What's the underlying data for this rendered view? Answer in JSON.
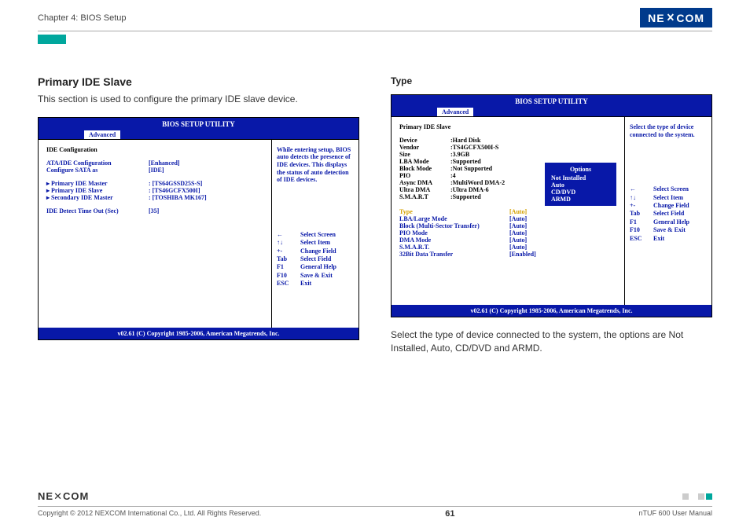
{
  "header": {
    "chapter": "Chapter 4: BIOS Setup",
    "brand": "NEXCOM"
  },
  "left": {
    "title": "Primary IDE Slave",
    "desc": "This section is used to configure the primary IDE slave device.",
    "bios": {
      "title": "BIOS SETUP UTILITY",
      "tab": "Advanced",
      "heading": "IDE Configuration",
      "rows1": [
        {
          "k": "ATA/IDE Configuration",
          "v": "[Enhanced]"
        },
        {
          "k": "Configure SATA as",
          "v": "[IDE]"
        }
      ],
      "rows2": [
        {
          "k": "▸ Primary IDE Master",
          "v": ":  [TS64GSSD25S-S]"
        },
        {
          "k": "▸ Primary IDE Slave",
          "v": ":  [TS46GCFX500I]"
        },
        {
          "k": "▸ Secondary IDE Master",
          "v": ":  [TOSHIBA MK167]"
        }
      ],
      "rows3": [
        {
          "k": "IDE Detect Time Out (Sec)",
          "v": "[35]"
        }
      ],
      "help": "While entering setup, BIOS auto detects the presence of IDE devices. This displays the status of auto detection of IDE devices.",
      "nav": [
        {
          "k": "←",
          "v": "Select Screen"
        },
        {
          "k": "↑↓",
          "v": "Select Item"
        },
        {
          "k": "+-",
          "v": "Change Field"
        },
        {
          "k": "Tab",
          "v": "Select Field"
        },
        {
          "k": "F1",
          "v": "General Help"
        },
        {
          "k": "F10",
          "v": "Save & Exit"
        },
        {
          "k": "ESC",
          "v": "Exit"
        }
      ],
      "copyright": "v02.61 (C) Copyright 1985-2006, American Megatrends, Inc."
    }
  },
  "right": {
    "title": "Type",
    "bios": {
      "title": "BIOS SETUP UTILITY",
      "tab": "Advanced",
      "heading": "Primary IDE Slave",
      "device": [
        {
          "k": "Device",
          "v": ":Hard Disk"
        },
        {
          "k": "Vendor",
          "v": ":TS4GCFX500I-S"
        },
        {
          "k": "Size",
          "v": ":3.9GB"
        },
        {
          "k": "LBA Mode",
          "v": ":Supported"
        },
        {
          "k": "Block Mode",
          "v": ":Not Supported"
        },
        {
          "k": "PIO",
          "v": ":4"
        },
        {
          "k": "Async DMA",
          "v": ":MultiWord DMA-2"
        },
        {
          "k": "Ultra DMA",
          "v": ":Ultra DMA-6"
        },
        {
          "k": "S.M.A.R.T",
          "v": ":Supported"
        }
      ],
      "settings": [
        {
          "k": "Type",
          "v": "[Auto]"
        },
        {
          "k": "LBA/Large Mode",
          "v": "[Auto]"
        },
        {
          "k": "Block (Multi-Sector Transfer)",
          "v": "[Auto]"
        },
        {
          "k": "PIO Mode",
          "v": "[Auto]"
        },
        {
          "k": "DMA Mode",
          "v": "[Auto]"
        },
        {
          "k": "S.M.A.R.T.",
          "v": "[Auto]"
        },
        {
          "k": "32Bit Data Transfer",
          "v": "[Enabled]"
        }
      ],
      "help": "Select the type of device connected to the system.",
      "popup": {
        "title": "Options",
        "items": [
          "Not Installed",
          "Auto",
          "CD/DVD",
          "ARMD"
        ]
      },
      "nav": [
        {
          "k": "←",
          "v": "Select Screen"
        },
        {
          "k": "↑↓",
          "v": "Select Item"
        },
        {
          "k": "+-",
          "v": "Change Field"
        },
        {
          "k": "Tab",
          "v": "Select Field"
        },
        {
          "k": "F1",
          "v": "General Help"
        },
        {
          "k": "F10",
          "v": "Save & Exit"
        },
        {
          "k": "ESC",
          "v": "Exit"
        }
      ],
      "copyright": "v02.61 (C) Copyright 1985-2006, American Megatrends, Inc."
    },
    "desc": "Select the type of device connected to the system, the options are Not Installed, Auto, CD/DVD and ARMD."
  },
  "footer": {
    "brand": "NEXCOM",
    "copyright": "Copyright © 2012 NEXCOM International Co., Ltd. All Rights Reserved.",
    "page": "61",
    "manual": "nTUF 600 User Manual"
  }
}
